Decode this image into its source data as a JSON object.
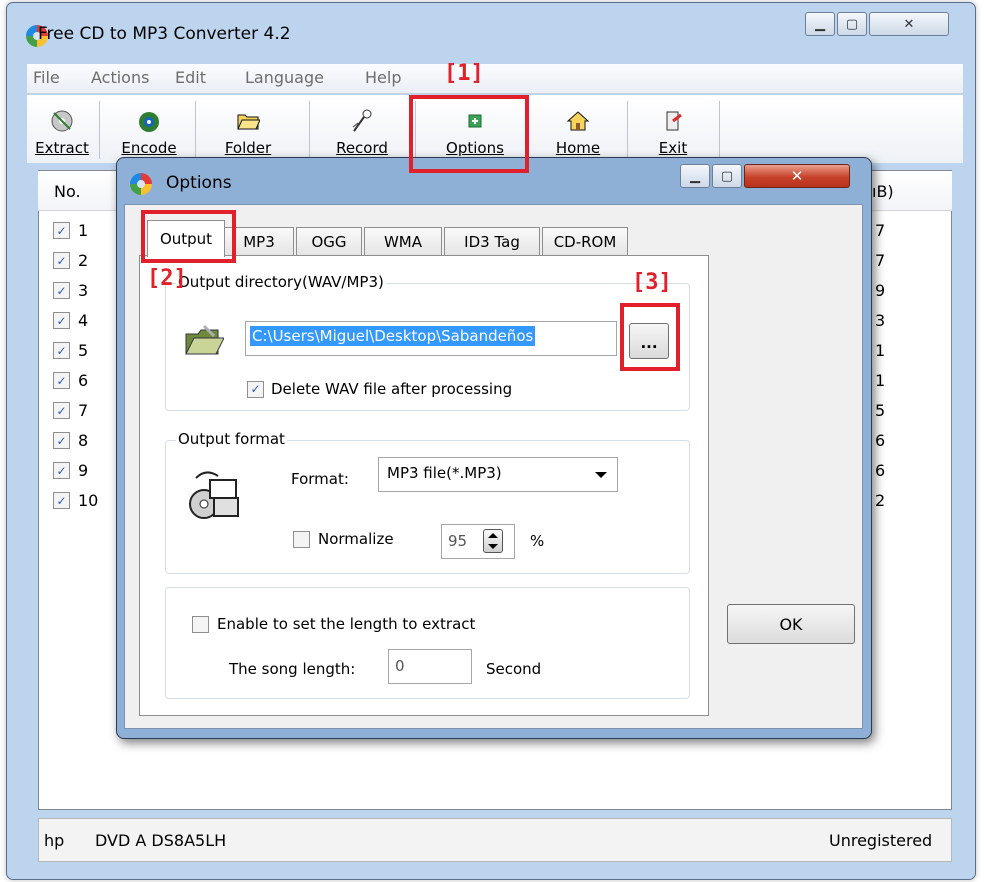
{
  "main_window": {
    "title": "Free CD to MP3 Converter 4.2",
    "menu": [
      "File",
      "Actions",
      "Edit",
      "Language",
      "Help"
    ],
    "toolbar": [
      {
        "label": "Extract",
        "icon": "extract-icon"
      },
      {
        "label": "Encode",
        "icon": "encode-icon"
      },
      {
        "label": "Folder",
        "icon": "folder-icon"
      },
      {
        "label": "Record",
        "icon": "record-icon"
      },
      {
        "label": "Options",
        "icon": "options-icon"
      },
      {
        "label": "Home",
        "icon": "home-icon"
      },
      {
        "label": "Exit",
        "icon": "exit-icon"
      }
    ],
    "list": {
      "col_no": "No.",
      "col_size_partial": "ıB)",
      "rows": [
        {
          "no": "1",
          "checked": true,
          "tail": "7"
        },
        {
          "no": "2",
          "checked": true,
          "tail": "7"
        },
        {
          "no": "3",
          "checked": true,
          "tail": "9"
        },
        {
          "no": "4",
          "checked": true,
          "tail": "3"
        },
        {
          "no": "5",
          "checked": true,
          "tail": "1"
        },
        {
          "no": "6",
          "checked": true,
          "tail": "1"
        },
        {
          "no": "7",
          "checked": true,
          "tail": "5"
        },
        {
          "no": "8",
          "checked": true,
          "tail": "6"
        },
        {
          "no": "9",
          "checked": true,
          "tail": "6"
        },
        {
          "no": "10",
          "checked": true,
          "tail": "2"
        }
      ]
    },
    "status": {
      "drive_vendor": "hp",
      "drive_model": "DVD A  DS8A5LH",
      "registration": "Unregistered"
    }
  },
  "options_dialog": {
    "title": "Options",
    "tabs": [
      "Output",
      "MP3",
      "OGG",
      "WMA",
      "ID3 Tag",
      "CD-ROM"
    ],
    "active_tab": "Output",
    "output_dir": {
      "group_title": "Output directory(WAV/MP3)",
      "path": "C:\\Users\\Miguel\\Desktop\\Sabandeños",
      "browse_label": "...",
      "delete_wav_label": "Delete WAV file after processing",
      "delete_wav_checked": true
    },
    "output_format": {
      "group_title": "Output format",
      "format_label": "Format:",
      "format_value": "MP3 file(*.MP3)",
      "normalize_label": "Normalize",
      "normalize_checked": false,
      "normalize_value": "95",
      "percent": "%"
    },
    "length": {
      "enable_label": "Enable to set the length to extract",
      "enable_checked": false,
      "song_length_label": "The song length:",
      "song_length_value": "0",
      "unit": "Second"
    },
    "ok_label": "OK"
  },
  "annotations": [
    {
      "label": "[1]"
    },
    {
      "label": "[2]"
    },
    {
      "label": "[3]"
    }
  ],
  "colors": {
    "annotation_red": "#e0202a",
    "selection_blue": "#3399ff",
    "frame_blue": "#bcd4ee"
  }
}
